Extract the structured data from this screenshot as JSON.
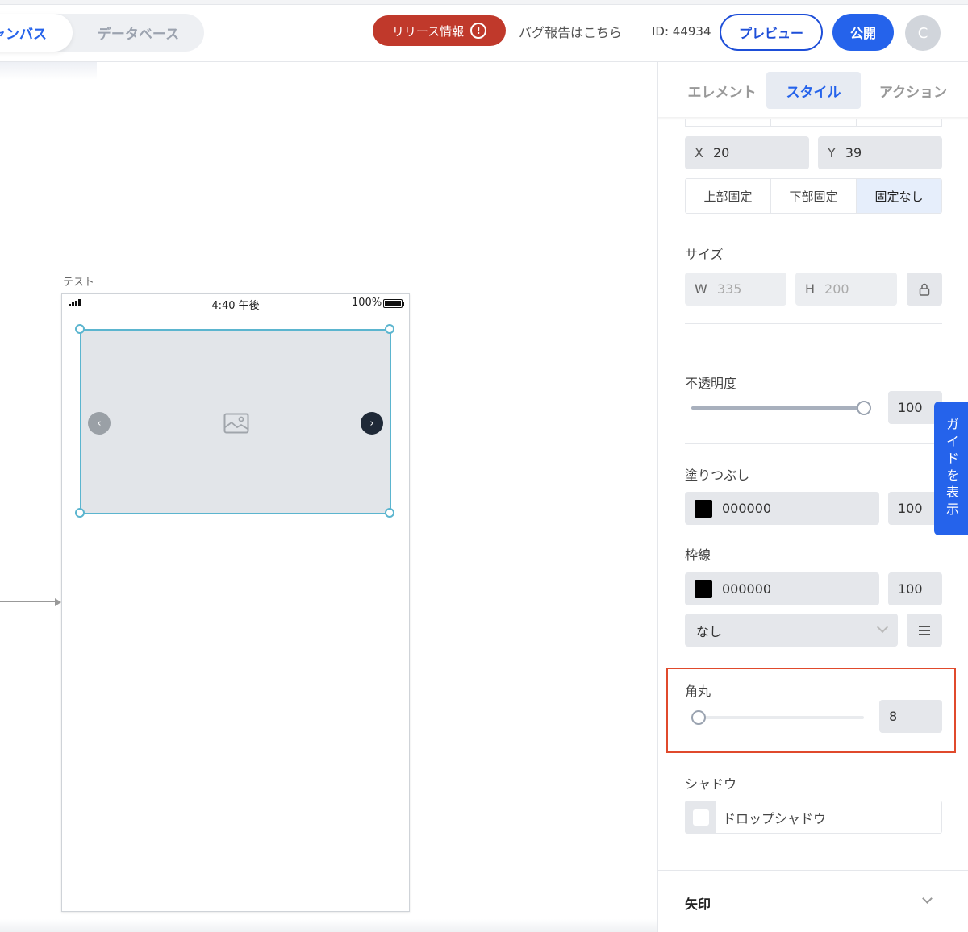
{
  "topbar": {
    "mode_canvas": "ャンバス",
    "mode_database": "データベース",
    "release_label": "リリース情報",
    "release_icon": "alert-circle-icon",
    "bug_report": "バグ報告はこちら",
    "project_id": "ID: 44934",
    "preview": "プレビュー",
    "publish": "公開",
    "avatar_letter": "C"
  },
  "canvas": {
    "screen_name": "テスト",
    "status_bar": {
      "time": "4:40 午後",
      "battery": "100%"
    },
    "carousel": {
      "prev_glyph": "‹",
      "next_glyph": "›",
      "placeholder_icon": "image-icon"
    }
  },
  "panel": {
    "tabs": [
      "エレメント",
      "スタイル",
      "アクション"
    ],
    "active_tab": "スタイル",
    "position": {
      "x_label": "X",
      "x_value": "20",
      "y_label": "Y",
      "y_value": "39",
      "anchor_options": [
        "上部固定",
        "下部固定",
        "固定なし"
      ],
      "anchor_selected": "固定なし"
    },
    "size": {
      "label": "サイズ",
      "w_label": "W",
      "w_value": "335",
      "h_label": "H",
      "h_value": "200",
      "lock_icon": "lock-icon"
    },
    "opacity": {
      "label": "不透明度",
      "value": "100",
      "slider_fraction": 1.0
    },
    "fill": {
      "label": "塗りつぶし",
      "color_hex": "000000",
      "opacity": "100"
    },
    "border": {
      "label": "枠線",
      "color_hex": "000000",
      "opacity": "100",
      "style": "なし"
    },
    "corner_radius": {
      "label": "角丸",
      "value": "8",
      "slider_fraction": 0.04
    },
    "shadow": {
      "label": "シャドウ",
      "option": "ドロップシャドウ"
    },
    "arrow_section": "矢印"
  },
  "guide_button": "ガイドを表示",
  "colors": {
    "accent": "#2563eb",
    "release": "#c0392b",
    "highlight": "#e04a2c",
    "selection": "#5bb5cf"
  }
}
